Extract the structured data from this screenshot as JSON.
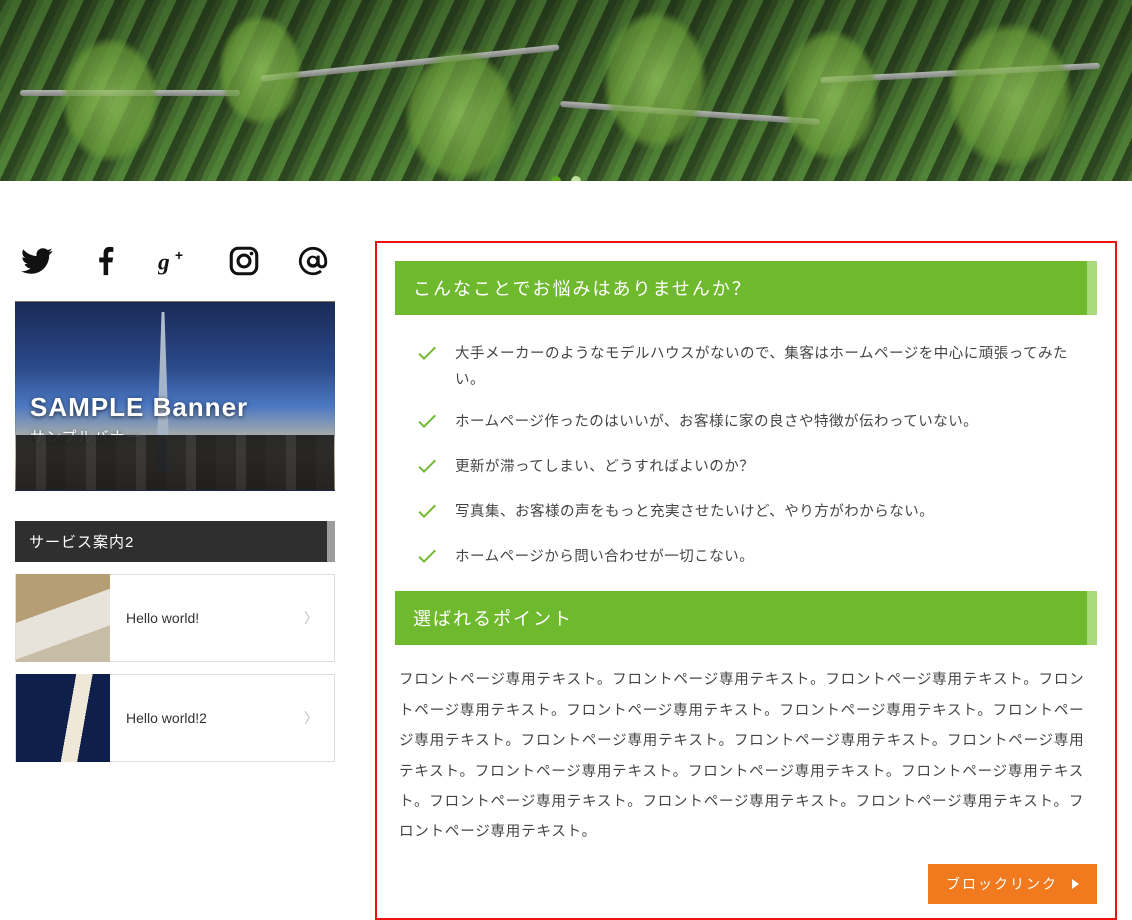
{
  "hero": {
    "dots": 2,
    "active_dot": 0
  },
  "social": [
    {
      "name": "twitter-icon"
    },
    {
      "name": "facebook-icon"
    },
    {
      "name": "googleplus-icon"
    },
    {
      "name": "instagram-icon"
    },
    {
      "name": "at-icon"
    }
  ],
  "banner": {
    "title": "SAMPLE Banner",
    "subtitle": "サンプルバナー"
  },
  "sidebar": {
    "section_title": "サービス案内2",
    "items": [
      {
        "label": "Hello world!"
      },
      {
        "label": "Hello world!2"
      }
    ]
  },
  "main": {
    "h1": "こんなことでお悩みはありませんか？",
    "worries": [
      "大手メーカーのようなモデルハウスがないので、集客はホームページを中心に頑張ってみたい。",
      "ホームページ作ったのはいいが、お客様に家の良さや特徴が伝わっていない。",
      "更新が滞ってしまい、どうすればよいのか？",
      "写真集、お客様の声をもっと充実させたいけど、やり方がわからない。",
      "ホームページから問い合わせが一切こない。"
    ],
    "h2": "選ばれるポイント",
    "paragraph": "フロントページ専用テキスト。フロントページ専用テキスト。フロントページ専用テキスト。フロントページ専用テキスト。フロントページ専用テキスト。フロントページ専用テキスト。フロントページ専用テキスト。フロントページ専用テキスト。フロントページ専用テキスト。フロントページ専用テキスト。フロントページ専用テキスト。フロントページ専用テキスト。フロントページ専用テキスト。フロントページ専用テキスト。フロントページ専用テキスト。フロントページ専用テキスト。フロントページ専用テキスト。",
    "cta_label": "ブロックリンク"
  }
}
